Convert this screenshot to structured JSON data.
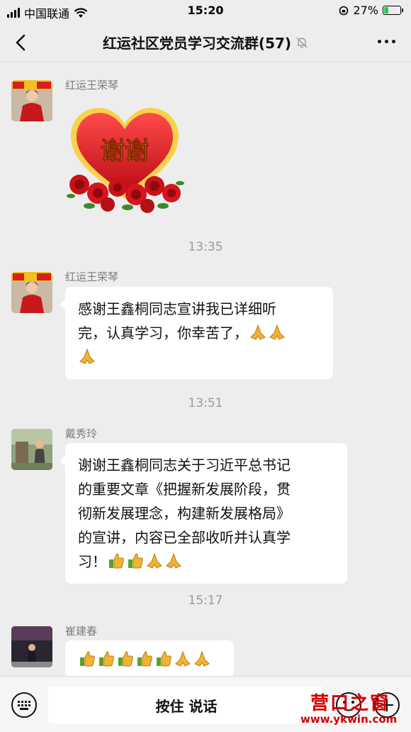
{
  "status_bar": {
    "carrier": "中国联通",
    "time": "15:20",
    "battery_text": "27%",
    "battery_level": 0.27
  },
  "nav": {
    "title": "红运社区党员学习交流群(57)"
  },
  "messages": [
    {
      "sender": "红运王荣琴",
      "type": "sticker",
      "sticker_text": "谢谢"
    },
    {
      "timestamp": "13:35"
    },
    {
      "sender": "红运王荣琴",
      "type": "text",
      "lines": [
        "感谢王鑫桐同志宣讲我已详细听",
        "完，认真学习，你幸苦了，"
      ]
    },
    {
      "timestamp": "13:51"
    },
    {
      "sender": "戴秀玲",
      "type": "text",
      "lines": [
        "谢谢王鑫桐同志关于习近平总书记",
        "的重要文章《把握新发展阶段，贯",
        "彻新发展理念，构建新发展格局》",
        "的宣讲，内容已全部收听并认真学",
        "习！"
      ]
    },
    {
      "timestamp": "15:17"
    },
    {
      "sender": "崔建春",
      "type": "emoji_only"
    }
  ],
  "input": {
    "press_to_talk": "按住 说话"
  },
  "watermark": {
    "name": "营口之窗",
    "url": "www.ykwin.com"
  },
  "colors": {
    "background": "#ededed",
    "bubble": "#ffffff",
    "heart": "#e4202a",
    "rose": "#d8141c",
    "watermark": "#d40000"
  },
  "icons": [
    "back-arrow-icon",
    "mute-bell-icon",
    "more-dots-icon",
    "keyboard-icon",
    "smiley-icon",
    "plus-icon",
    "thumbs-up-icon",
    "praying-hands-icon"
  ]
}
